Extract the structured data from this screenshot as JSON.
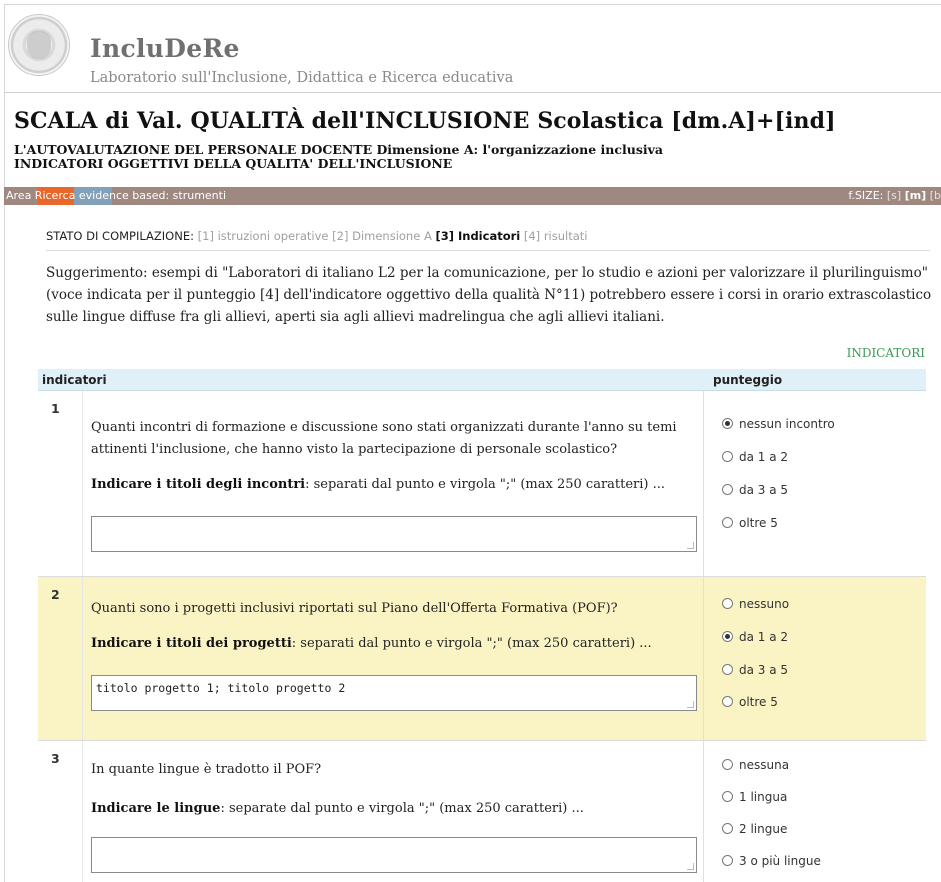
{
  "header": {
    "brand": "IncluDeRe",
    "subtitle": "Laboratorio sull'Inclusione, Didattica e Ricerca educativa"
  },
  "page": {
    "title": "SCALA di Val. QUALITÀ dell'INCLUSIONE Scolastica [dm.A]+[ind]",
    "subtitle_line1": "L'AUTOVALUTAZIONE DEL PERSONALE DOCENTE Dimensione A: l'organizzazione inclusiva",
    "subtitle_line2": "INDICATORI OGGETTIVI DELLA QUALITA' DELL'INCLUSIONE"
  },
  "areabar": {
    "text": "Area Ricerca evidence based: strumenti",
    "fsize_label": "f.SIZE:",
    "fsize_s": "[s]",
    "fsize_m": "[m]",
    "fsize_b": "[b"
  },
  "stato": {
    "label": "STATO DI COMPILAZIONE:",
    "step1": "[1] istruzioni operative",
    "step2": "[2] Dimensione A",
    "step3": "[3] Indicatori",
    "step4": "[4] risultati"
  },
  "suggestion": "Suggerimento: esempi di \"Laboratori di italiano L2 per la comunicazione, per lo studio e azioni per valorizzare il plurilinguismo\" (voce indicata per il punteggio [4] dell'indicatore oggettivo della qualità N°11) potrebbero essere i corsi in orario extrascolastico sulle lingue diffuse fra gli allievi, aperti sia agli allievi madrelingua che agli allievi italiani.",
  "indicatori_link": "INDICATORI",
  "table": {
    "col1": "indicatori",
    "col2": "punteggio",
    "rows": [
      {
        "num": "1",
        "question": "Quanti incontri di formazione e discussione sono stati organizzati durante l'anno su temi attinenti l'inclusione, che hanno visto la partecipazione di personale scolastico?",
        "note_bold": "Indicare i titoli degli incontri",
        "note_rest": ": separati dal punto e virgola \";\" (max 250 caratteri) ...",
        "value": "",
        "options": [
          "nessun incontro",
          "da 1 a 2",
          "da 3 a 5",
          "oltre 5"
        ],
        "selected": 0
      },
      {
        "num": "2",
        "question": "Quanti sono i progetti inclusivi riportati sul Piano dell'Offerta Formativa (POF)?",
        "note_bold": "Indicare i titoli dei progetti",
        "note_rest": ": separati dal punto e virgola \";\" (max 250 caratteri) ...",
        "value": "titolo progetto 1; titolo progetto 2",
        "options": [
          "nessuno",
          "da 1 a 2",
          "da 3 a 5",
          "oltre 5"
        ],
        "selected": 1
      },
      {
        "num": "3",
        "question": "In quante lingue è tradotto il POF?",
        "note_bold": "Indicare le lingue",
        "note_rest": ": separate dal punto e virgola \";\" (max 250 caratteri) ...",
        "value": "",
        "options": [
          "nessuna",
          "1 lingua",
          "2 lingue",
          "3 o più lingue"
        ],
        "selected": -1
      }
    ]
  },
  "colors": {
    "areabar": "#9e8880",
    "orange": "#e8672a",
    "blue": "#82a0b8",
    "highlight_row": "#faf4c4",
    "table_header": "#dff0f8",
    "link_green": "#3a9a55"
  }
}
